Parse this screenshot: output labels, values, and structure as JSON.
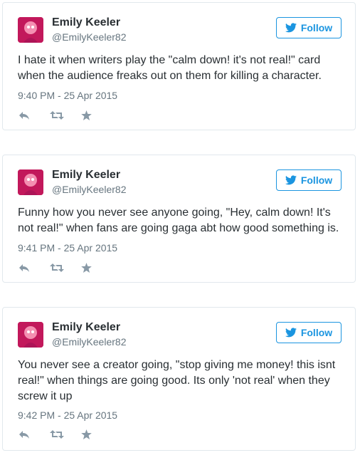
{
  "tweets": [
    {
      "name": "Emily Keeler",
      "handle": "@EmilyKeeler82",
      "follow_label": "Follow",
      "text": "I hate it when writers play the \"calm down! it's not real!\" card when the audience freaks out on them for killing a character.",
      "timestamp": "9:40 PM - 25 Apr 2015"
    },
    {
      "name": "Emily Keeler",
      "handle": "@EmilyKeeler82",
      "follow_label": "Follow",
      "text": "Funny how you never see anyone going, \"Hey, calm down! It's not real!\" when fans are going gaga abt how good something is.",
      "timestamp": "9:41 PM - 25 Apr 2015"
    },
    {
      "name": "Emily Keeler",
      "handle": "@EmilyKeeler82",
      "follow_label": "Follow",
      "text": "You never see a creator going, \"stop giving me money! this isnt real!\" when things are going good. Its only 'not real' when they screw it up",
      "timestamp": "9:42 PM - 25 Apr 2015"
    }
  ],
  "colors": {
    "link_blue": "#1b95e0",
    "muted_gray": "#66757f",
    "icon_gray": "#8899a6",
    "border": "#e1e8ed"
  },
  "icons": [
    "twitter-bird-icon",
    "reply-icon",
    "retweet-icon",
    "favorite-star-icon"
  ]
}
